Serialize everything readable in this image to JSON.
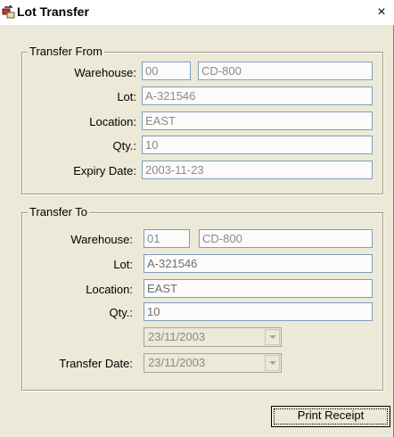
{
  "window": {
    "title": "Lot Transfer",
    "close_label": "×"
  },
  "transfer_from": {
    "legend": "Transfer From",
    "warehouse_label": "Warehouse:",
    "warehouse_code": "00",
    "warehouse_name": "CD-800",
    "lot_label": "Lot:",
    "lot": "A-321546",
    "location_label": "Location:",
    "location": "EAST",
    "qty_label": "Qty.:",
    "qty": "10",
    "expiry_label": "Expiry Date:",
    "expiry_date": "2003-11-23"
  },
  "transfer_to": {
    "legend": "Transfer To",
    "warehouse_label": "Warehouse:",
    "warehouse_code": "01",
    "warehouse_name": "CD-800",
    "lot_label": "Lot:",
    "lot": "A-321546",
    "location_label": "Location:",
    "location": "EAST",
    "qty_label": "Qty.:",
    "qty": "10",
    "date_combo_value": "23/11/2003",
    "transfer_date_label": "Transfer Date:",
    "transfer_date": "23/11/2003"
  },
  "actions": {
    "print_receipt": "Print Receipt"
  },
  "icons": {
    "title_icon": "boxes-transfer-icon",
    "dropdown": "chevron-down-icon"
  }
}
